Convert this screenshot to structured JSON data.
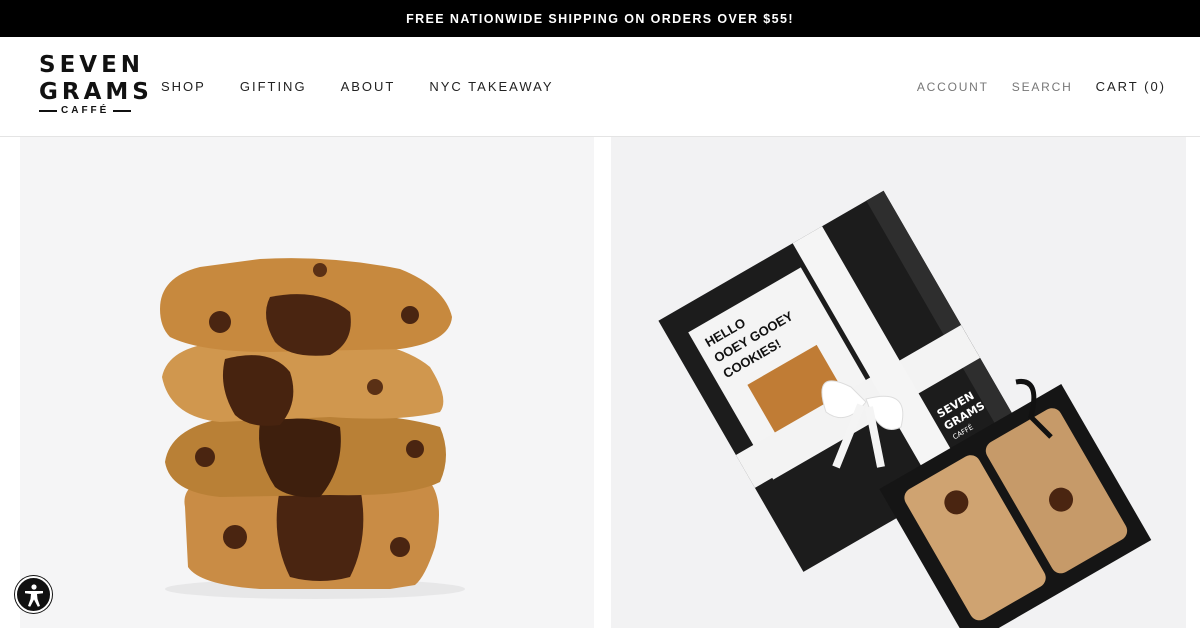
{
  "announcement": {
    "text": "FREE NATIONWIDE SHIPPING ON ORDERS OVER $55!"
  },
  "logo": {
    "line1": "SEVEN",
    "line2": "GRAMS",
    "line3": "CAFFÉ"
  },
  "nav": {
    "items": [
      {
        "label": "SHOP"
      },
      {
        "label": "GIFTING"
      },
      {
        "label": "ABOUT"
      },
      {
        "label": "NYC TAKEAWAY"
      }
    ]
  },
  "utility": {
    "account": "ACCOUNT",
    "search": "SEARCH",
    "cart": "CART (0)"
  },
  "gift_box": {
    "card_lines": [
      "HELLO",
      "OOEY GOOEY",
      "COOKIES!"
    ],
    "lid_brand": [
      "SEVEN",
      "GRAMS",
      "CAFFÉ"
    ]
  },
  "colors": {
    "announcement_bg": "#000000",
    "header_bg": "#ffffff",
    "nav_text": "#222222",
    "muted_text": "#777777"
  },
  "icons": {
    "accessibility": "accessibility-icon"
  }
}
